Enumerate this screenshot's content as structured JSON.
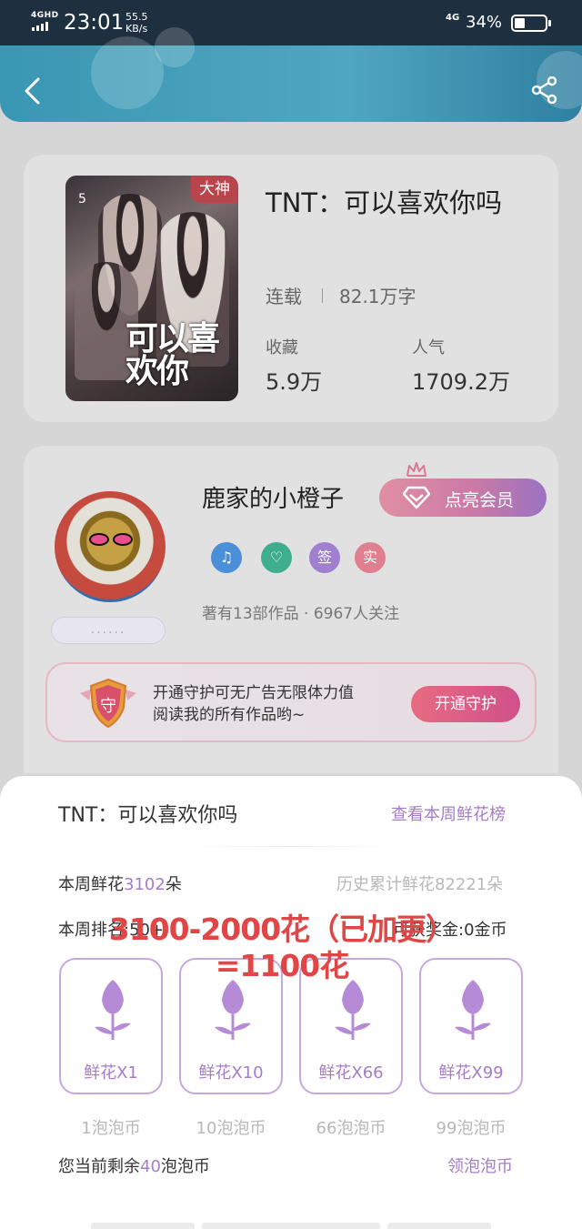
{
  "status_bar": {
    "network_type": "4GHD",
    "time": "23:01",
    "speed_value": "55.5",
    "speed_unit": "KB/s",
    "network_type_right": "4G",
    "battery_percent": "34%"
  },
  "book": {
    "cover_tag": "大神",
    "cover_number": "5",
    "cover_text": "可以喜欢你",
    "title": "TNT：可以喜欢你吗",
    "status": "连载",
    "word_count": "82.1万字",
    "favorites_label": "收藏",
    "favorites_value": "5.9万",
    "popularity_label": "人气",
    "popularity_value": "1709.2万"
  },
  "author": {
    "name": "鹿家的小橙子",
    "avatar_caption": "......",
    "vip_button": "点亮会员",
    "badges": [
      {
        "label": "♫",
        "color": "#4a8fd8"
      },
      {
        "label": "♡",
        "color": "#3fae8f"
      },
      {
        "label": "签",
        "color": "#a07fd0"
      },
      {
        "label": "实",
        "color": "#e07f8f"
      }
    ],
    "works_info": "著有13部作品 · 6967人关注"
  },
  "guard": {
    "shield_label": "守",
    "text_line1": "开通守护可无广告无限体力值",
    "text_line2": "阅读我的所有作品哟~",
    "button": "开通守护"
  },
  "flower_sheet": {
    "title": "TNT：可以喜欢你吗",
    "link": "查看本周鲜花榜",
    "weekly_prefix": "本周鲜花",
    "weekly_count": "3102",
    "weekly_suffix": "朵",
    "history": "历史累计鲜花82221朵",
    "rank_prefix": "本周排名:",
    "rank_value": "50+",
    "reward_prefix": "可获奖金:",
    "reward_value": "0金币",
    "overlay_note_line1": "3100-2000花（已加更）",
    "overlay_note_line2": "=1100花",
    "options": [
      {
        "label": "鲜花X1",
        "price": "1泡泡币"
      },
      {
        "label": "鲜花X10",
        "price": "10泡泡币"
      },
      {
        "label": "鲜花X66",
        "price": "66泡泡币"
      },
      {
        "label": "鲜花X99",
        "price": "99泡泡币"
      }
    ],
    "balance_prefix": "您当前剩余",
    "balance_value": "40",
    "balance_suffix": "泡泡币",
    "get_coins_link": "领泡泡币"
  },
  "colors": {
    "accent_purple": "#a67cc9",
    "header_blue": "#4fa6c2",
    "overlay_red": "#e24545",
    "cover_tag_red": "#b8444c"
  }
}
